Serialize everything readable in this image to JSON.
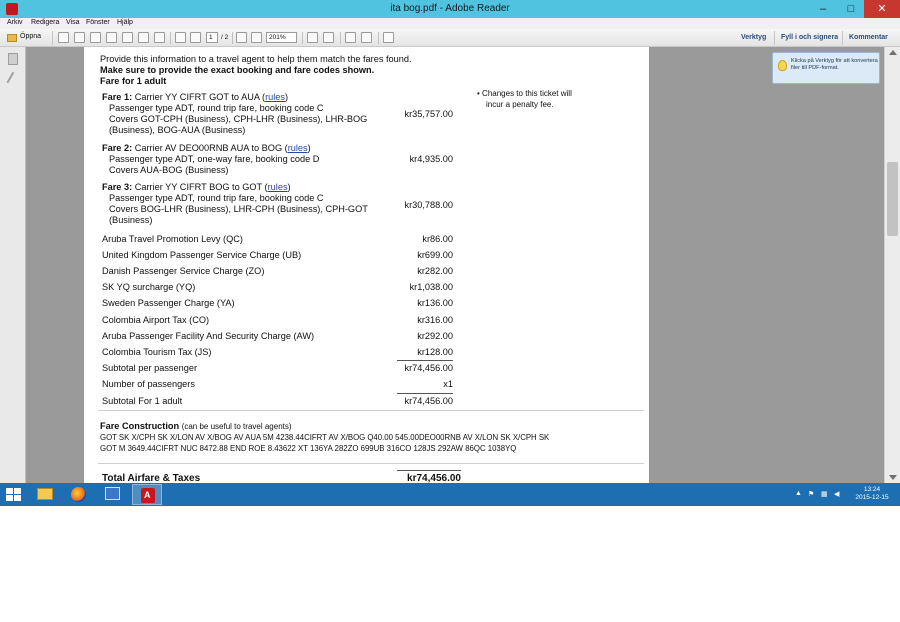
{
  "window": {
    "title": "ita bog.pdf - Adobe Reader",
    "minimize": "–",
    "maximize": "□",
    "close": "✕"
  },
  "menu": [
    "Arkiv",
    "Redigera",
    "Visa",
    "Fönster",
    "Hjälp"
  ],
  "toolbar": {
    "open_label": "Öppna",
    "page_number": "1",
    "page_total": "/ 2",
    "zoom": "201%",
    "right_links": [
      "Verktyg",
      "Fyll i och signera",
      "Kommentar"
    ]
  },
  "tip": {
    "text": "Klicka på Verktyg för att konvertera filer till PDF-format."
  },
  "document": {
    "intro_line": "Provide this information to a travel agent to help them match the fares found.",
    "bold_line": "Make sure to provide the exact booking and fare codes shown.",
    "fare_for": "Fare for 1 adult",
    "rules_link": "rules",
    "fares": [
      {
        "label": "Fare 1:",
        "carrier": "Carrier YY CIFRT GOT to AUA (",
        "lines": [
          "Passenger type ADT, round trip fare, booking code C",
          "Covers GOT-CPH (Business), CPH-LHR (Business), LHR-BOG",
          "(Business), BOG-AUA (Business)"
        ],
        "amount": "kr35,757.00"
      },
      {
        "label": "Fare 2:",
        "carrier": "Carrier AV DEO00RNB AUA to BOG (",
        "lines": [
          "Passenger type ADT, one-way fare, booking code D",
          "Covers AUA-BOG (Business)"
        ],
        "amount": "kr4,935.00"
      },
      {
        "label": "Fare 3:",
        "carrier": "Carrier YY CIFRT BOG to GOT (",
        "lines": [
          "Passenger type ADT, round trip fare, booking code C",
          "Covers BOG-LHR (Business), LHR-CPH (Business), CPH-GOT",
          "(Business)"
        ],
        "amount": "kr30,788.00"
      }
    ],
    "close_paren": ")",
    "taxes": [
      {
        "name": "Aruba Travel Promotion Levy (QC)",
        "amount": "kr86.00"
      },
      {
        "name": "United Kingdom Passenger Service Charge (UB)",
        "amount": "kr699.00"
      },
      {
        "name": "Danish Passenger Service Charge (ZO)",
        "amount": "kr282.00"
      },
      {
        "name": "SK YQ surcharge (YQ)",
        "amount": "kr1,038.00"
      },
      {
        "name": "Sweden Passenger Charge (YA)",
        "amount": "kr136.00"
      },
      {
        "name": "Colombia Airport Tax (CO)",
        "amount": "kr316.00"
      },
      {
        "name": "Aruba Passenger Facility And Security Charge (AW)",
        "amount": "kr292.00"
      },
      {
        "name": "Colombia Tourism Tax (JS)",
        "amount": "kr128.00"
      }
    ],
    "subtotal_per_passenger": {
      "label": "Subtotal per passenger",
      "amount": "kr74,456.00"
    },
    "num_passengers": {
      "label": "Number of passengers",
      "amount": "x1"
    },
    "subtotal_adult": {
      "label": "Subtotal For 1 adult",
      "amount": "kr74,456.00"
    },
    "fare_construction": {
      "title": "Fare Construction",
      "note": "(can be useful to travel agents)",
      "line1": "GOT SK X/CPH SK X/LON AV X/BOG AV AUA 5M 4238.44CIFRT AV X/BOG Q40.00 545.00DEO00RNB AV X/LON SK X/CPH SK",
      "line2": "GOT M 3649.44CIFRT NUC 8472.88 END ROE 8.43622 XT 136YA 282ZO 699UB 316CO 128JS 292AW 86QC 1038YQ"
    },
    "total": {
      "label": "Total Airfare & Taxes",
      "amount": "kr74,456.00"
    },
    "note_bullet": "•",
    "note_line1": "Changes to this ticket will",
    "note_line2": "incur a penalty fee."
  },
  "taskbar": {
    "clock_time": "13:24",
    "clock_date": "2015-12-15"
  }
}
